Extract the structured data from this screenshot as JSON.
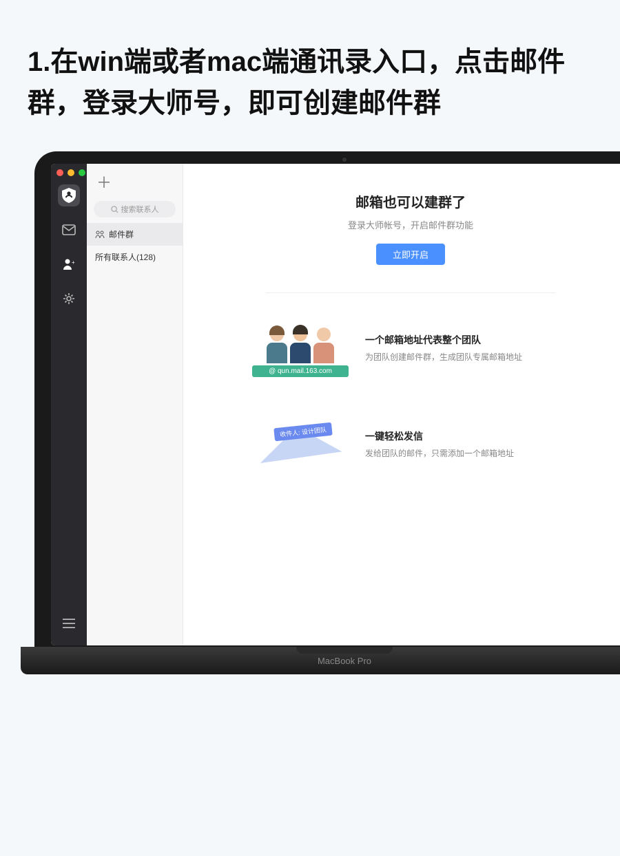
{
  "headline": "1.在win端或者mac端通讯录入口，点击邮件群，登录大师号，即可创建邮件群",
  "search": {
    "placeholder": "搜索联系人"
  },
  "sidebar": {
    "items": [
      {
        "label": "邮件群"
      },
      {
        "label": "所有联系人(128)"
      }
    ]
  },
  "hero": {
    "title": "邮箱也可以建群了",
    "subtitle": "登录大师帐号，开启邮件群功能",
    "button": "立即开启"
  },
  "features": [
    {
      "badge": "@ qun.mail.163.com",
      "title": "一个邮箱地址代表整个团队",
      "desc": "为团队创建邮件群，生成团队专属邮箱地址"
    },
    {
      "tag": "收件人: 设计团队",
      "title": "一键轻松发信",
      "desc": "发给团队的邮件，只需添加一个邮箱地址"
    }
  ],
  "device": "MacBook Pro"
}
